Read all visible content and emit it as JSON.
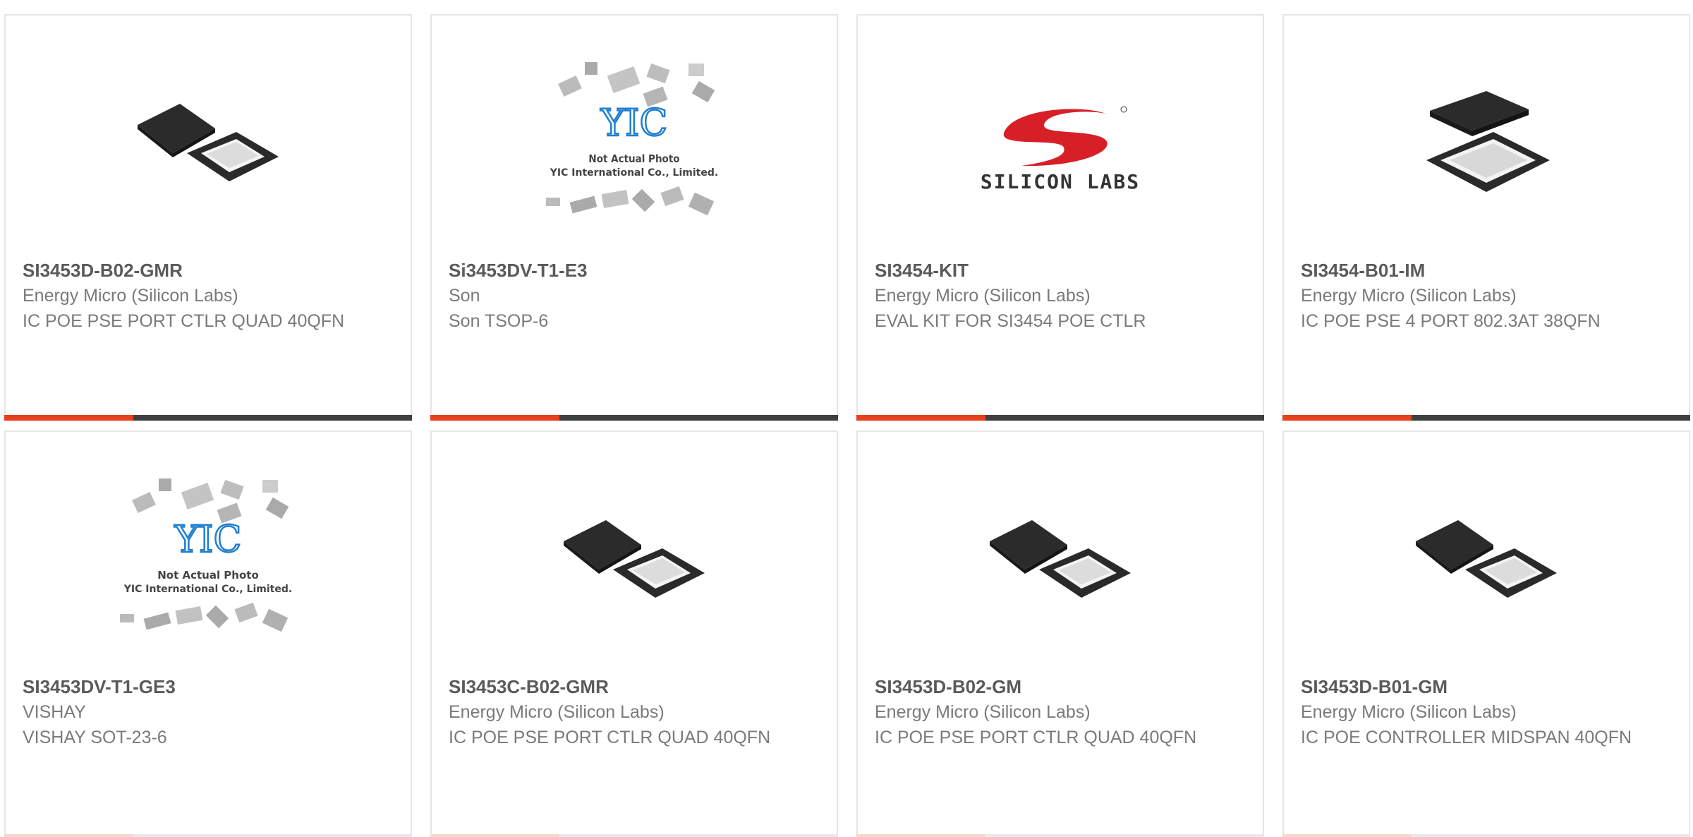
{
  "products": [
    {
      "part_number": "SI3453D-B02-GMR",
      "manufacturer": "Energy Micro (Silicon Labs)",
      "description": "IC POE PSE PORT CTLR QUAD 40QFN",
      "image": "qfn-chip-pair-icon"
    },
    {
      "part_number": "Si3453DV-T1-E3",
      "manufacturer": "Son",
      "description": "Son TSOP-6",
      "image": "yic-placeholder-icon",
      "placeholder_text": [
        "Not Actual Photo",
        "YIC International Co., Limited."
      ],
      "placeholder_logo": "YIC"
    },
    {
      "part_number": "SI3454-KIT",
      "manufacturer": "Energy Micro (Silicon Labs)",
      "description": "EVAL KIT FOR SI3454 POE CTLR",
      "image": "silicon-labs-logo",
      "logo_text": "SILICON LABS"
    },
    {
      "part_number": "SI3454-B01-IM",
      "manufacturer": "Energy Micro (Silicon Labs)",
      "description": "IC POE PSE 4 PORT 802.3AT 38QFN",
      "image": "qfn-chip-stack-icon"
    },
    {
      "part_number": "SI3453DV-T1-GE3",
      "manufacturer": "VISHAY",
      "description": "VISHAY SOT-23-6",
      "image": "yic-placeholder-icon",
      "placeholder_text": [
        "Not Actual Photo",
        "YIC International Co., Limited."
      ],
      "placeholder_logo": "YIC"
    },
    {
      "part_number": "SI3453C-B02-GMR",
      "manufacturer": "Energy Micro (Silicon Labs)",
      "description": "IC POE PSE PORT CTLR QUAD 40QFN",
      "image": "qfn-chip-pair-icon"
    },
    {
      "part_number": "SI3453D-B02-GM",
      "manufacturer": "Energy Micro (Silicon Labs)",
      "description": "IC POE PSE PORT CTLR QUAD 40QFN",
      "image": "qfn-chip-pair-icon"
    },
    {
      "part_number": "SI3453D-B01-GM",
      "manufacturer": "Energy Micro (Silicon Labs)",
      "description": "IC POE CONTROLLER MIDSPAN 40QFN",
      "image": "qfn-chip-pair-icon"
    }
  ],
  "colors": {
    "accent": "#e8401c",
    "bar": "#3f3f3f",
    "border": "#e6e6e6",
    "text": "#7a7a7a",
    "logo_red": "#d71f27"
  }
}
